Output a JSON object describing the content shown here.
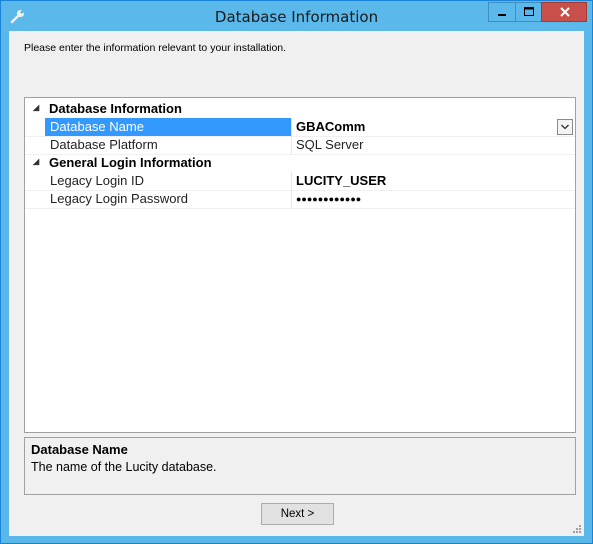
{
  "window": {
    "title": "Database Information"
  },
  "prompt": "Please enter the information relevant to your installation.",
  "categories": [
    {
      "label": "Database Information",
      "properties": [
        {
          "name": "Database Name",
          "value": "GBAComm"
        },
        {
          "name": "Database Platform",
          "value": "SQL Server"
        }
      ]
    },
    {
      "label": "General Login Information",
      "properties": [
        {
          "name": "Legacy Login ID",
          "value": "LUCITY_USER"
        },
        {
          "name": "Legacy Login Password",
          "value": "●●●●●●●●●●●●"
        }
      ]
    }
  ],
  "description": {
    "title": "Database Name",
    "text": "The name of the Lucity database."
  },
  "buttons": {
    "next": "Next >"
  },
  "colors": {
    "titlebar": "#5bb8ea",
    "selection": "#3399ff",
    "close": "#c7504a"
  }
}
